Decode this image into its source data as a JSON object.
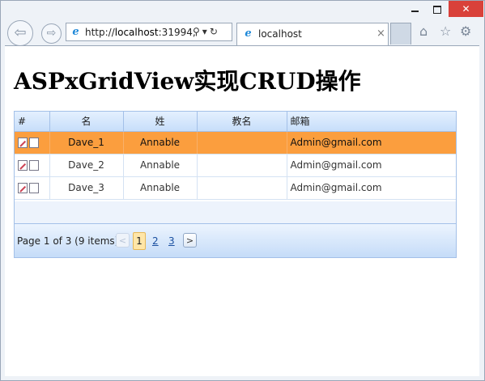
{
  "window": {
    "minimize_label": "",
    "close_label": "✕"
  },
  "browser": {
    "address_prefix": "http://",
    "address_host": "localhost",
    "address_rest": ":31994,",
    "tab_title": "localhost",
    "tab_close": "×"
  },
  "page": {
    "title": "ASPxGridView实现CRUD操作"
  },
  "grid": {
    "columns": [
      "#",
      "名",
      "姓",
      "教名",
      "邮箱"
    ],
    "rows": [
      {
        "first": "Dave_1",
        "last": "Annable",
        "christian": "",
        "email": "Admin@gmail.com",
        "selected": true
      },
      {
        "first": "Dave_2",
        "last": "Annable",
        "christian": "",
        "email": "Admin@gmail.com",
        "selected": false
      },
      {
        "first": "Dave_3",
        "last": "Annable",
        "christian": "",
        "email": "Admin@gmail.com",
        "selected": false
      }
    ],
    "pager": {
      "summary": "Page 1 of 3 (9 items)",
      "pages": [
        "1",
        "2",
        "3"
      ],
      "current": "1",
      "prev": "<",
      "next": ">"
    },
    "selected_row_color": "#fb9e3e"
  }
}
